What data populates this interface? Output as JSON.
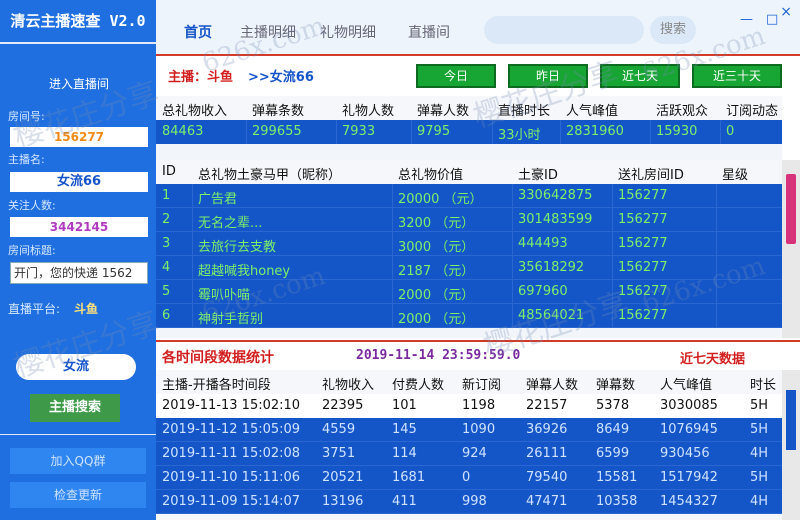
{
  "app": {
    "title": "清云主播速查 V2.0"
  },
  "sidebar": {
    "enter_room": "进入直播间",
    "room_label": "房间号:",
    "room_value": "156277",
    "anchor_label": "主播名:",
    "anchor_value": "女流66",
    "follow_label": "关注人数:",
    "follow_value": "3442145",
    "title_label": "房间标题:",
    "title_value": "开门，您的快递 1562",
    "platform_label": "直播平台:",
    "platform_value": "斗鱼",
    "search_value": "女流",
    "search_btn": "主播搜索",
    "qq_btn": "加入QQ群",
    "update_btn": "检查更新"
  },
  "nav": {
    "tabs": [
      "首页",
      "主播明细",
      "礼物明细",
      "直播间"
    ],
    "search_btn": "搜索",
    "minimize": "—",
    "maximize": "□",
    "close": "×"
  },
  "streamer": {
    "label": "主播：斗鱼",
    "name": ">>女流66"
  },
  "ranges": [
    "今日",
    "昨日",
    "近七天",
    "近三十天"
  ],
  "stats": {
    "headers": [
      "总礼物收入",
      "弹幕条数",
      "礼物人数",
      "弹幕人数",
      "直播时长",
      "人气峰值",
      "活跃观众",
      "订阅动态"
    ],
    "values": [
      "84463",
      "299655",
      "7933",
      "9795",
      "33小时",
      "2831960",
      "15930",
      "0"
    ]
  },
  "gifts": {
    "headers": [
      "ID",
      "总礼物土豪马甲（昵称）",
      "总礼物价值",
      "土豪ID",
      "送礼房间ID",
      "星级"
    ],
    "rows": [
      [
        "1",
        "广告君",
        "20000 （元）",
        "330642875",
        "156277",
        ""
      ],
      [
        "2",
        "无名之辈...",
        "3200 （元）",
        "301483599",
        "156277",
        ""
      ],
      [
        "3",
        "去旅行去支教",
        "3000 （元）",
        "444493",
        "156277",
        ""
      ],
      [
        "4",
        "超越喊我honey",
        "2187 （元）",
        "35618292",
        "156277",
        ""
      ],
      [
        "5",
        "霉叭卟喵",
        "2000 （元）",
        "697960",
        "156277",
        ""
      ],
      [
        "6",
        "神射手哲别",
        "2000 （元）",
        "48564021",
        "156277",
        ""
      ]
    ]
  },
  "section": {
    "title": "各时间段数据统计",
    "time": "2019-11-14 23:59:59.0",
    "range": "近七天数据"
  },
  "daily": {
    "headers": [
      "主播-开播各时间段",
      "礼物收入",
      "付费人数",
      "新订阅",
      "弹幕人数",
      "弹幕数",
      "人气峰值",
      "时长"
    ],
    "rows": [
      [
        "2019-11-13 15:02:10",
        "22395",
        "101",
        "1198",
        "22157",
        "5378",
        "3030085",
        "5H"
      ],
      [
        "2019-11-12 15:05:09",
        "4559",
        "145",
        "1090",
        "36926",
        "8649",
        "1076945",
        "5H"
      ],
      [
        "2019-11-11 15:02:08",
        "3751",
        "114",
        "924",
        "26111",
        "6599",
        "930456",
        "4H"
      ],
      [
        "2019-11-10 15:11:06",
        "20521",
        "1681",
        "0",
        "79540",
        "15581",
        "1517942",
        "5H"
      ],
      [
        "2019-11-09 15:14:07",
        "13196",
        "411",
        "998",
        "47471",
        "10358",
        "1454327",
        "4H"
      ]
    ]
  },
  "watermarks": [
    "樱花庄分享",
    "626x.com"
  ]
}
